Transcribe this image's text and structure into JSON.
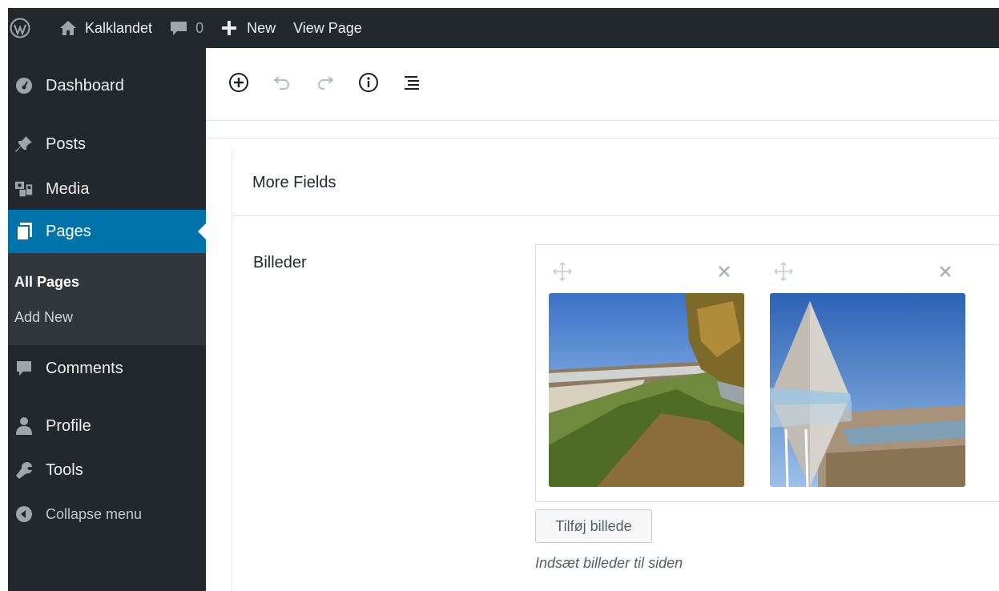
{
  "adminbar": {
    "site_name": "Kalklandet",
    "comment_count": "0",
    "new_label": "New",
    "view_page_label": "View Page"
  },
  "sidebar": {
    "dashboard": "Dashboard",
    "posts": "Posts",
    "media": "Media",
    "pages": "Pages",
    "submenu": {
      "all_pages": "All Pages",
      "add_new": "Add New"
    },
    "comments": "Comments",
    "profile": "Profile",
    "tools": "Tools",
    "collapse": "Collapse menu"
  },
  "toolbar": {
    "icons": [
      "add-block-icon",
      "undo-icon",
      "redo-icon",
      "info-icon",
      "outline-icon"
    ]
  },
  "metabox": {
    "title": "More Fields",
    "field_label": "Billeder",
    "add_button": "Tilføj billede",
    "instructions": "Indsæt billeder til siden"
  },
  "colors": {
    "adminbar_bg": "#23282d",
    "sidebar_bg": "#23282d",
    "submenu_bg": "#32373c",
    "active_bg": "#0073aa"
  }
}
